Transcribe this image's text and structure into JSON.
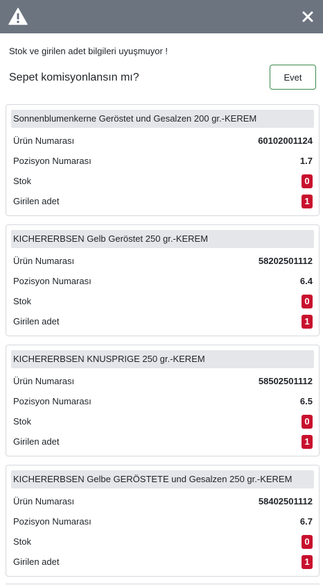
{
  "header": {
    "bg": "#6c7480"
  },
  "message": "Stok ve girilen adet bilgileri uyuşmuyor !",
  "question": "Sepet komisyonlansın mı?",
  "confirm_label": "Evet",
  "labels": {
    "product_number": "Ürün Numarası",
    "position_number": "Pozisyon Numarası",
    "stock": "Stok",
    "entered_qty": "Girilen adet"
  },
  "items": [
    {
      "title": "Sonnenblumenkerne Geröstet und Gesalzen 200 gr.-KEREM",
      "product_number": "60102001124",
      "position_number": "1.7",
      "stock": "0",
      "entered_qty": "1"
    },
    {
      "title": "KICHERERBSEN Gelb Geröstet 250 gr.-KEREM",
      "product_number": "58202501112",
      "position_number": "6.4",
      "stock": "0",
      "entered_qty": "1"
    },
    {
      "title": "KICHERERBSEN KNUSPRIGE 250 gr.-KEREM",
      "product_number": "58502501112",
      "position_number": "6.5",
      "stock": "0",
      "entered_qty": "1"
    },
    {
      "title": "KICHERERBSEN Gelbe GERÖSTETE und Gesalzen 250 gr.-KEREM",
      "product_number": "58402501112",
      "position_number": "6.7",
      "stock": "0",
      "entered_qty": "1"
    }
  ],
  "icons": {
    "warning": "warning-triangle-icon",
    "close": "close-icon"
  },
  "colors": {
    "badge": "#c8102e",
    "confirm_border": "#3a8a4a",
    "title_bg": "#e4e6ea"
  }
}
